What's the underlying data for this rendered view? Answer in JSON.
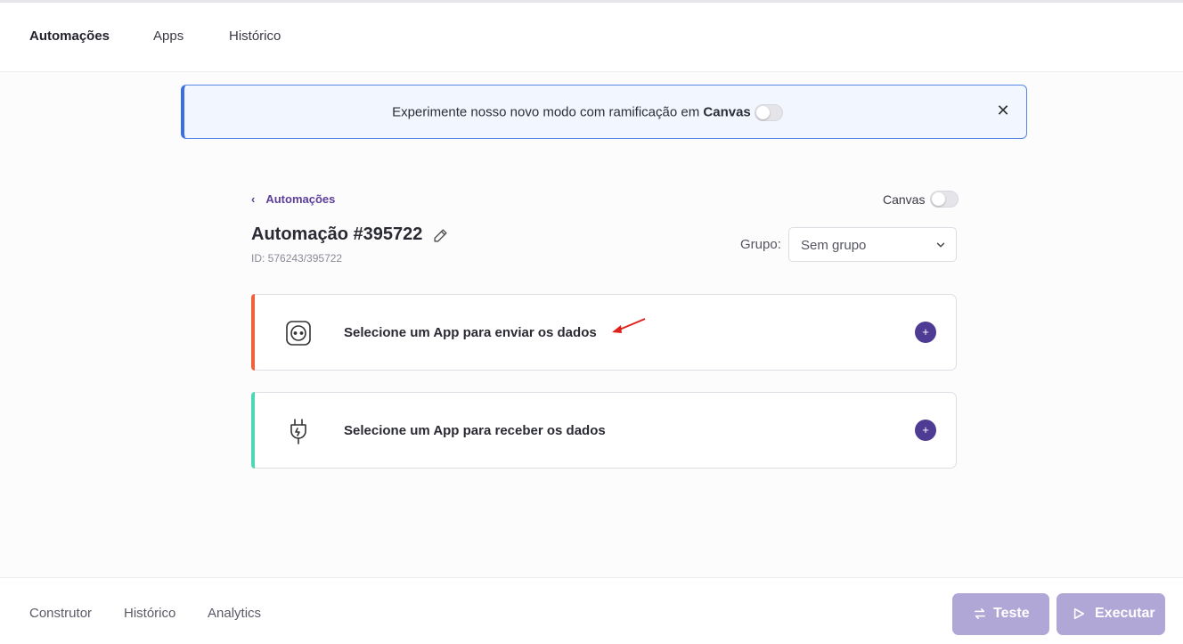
{
  "nav": {
    "tabs": [
      {
        "label": "Automações",
        "active": true
      },
      {
        "label": "Apps",
        "active": false
      },
      {
        "label": "Histórico",
        "active": false
      }
    ]
  },
  "banner": {
    "text": "Experimente nosso novo modo com ramificação em",
    "highlight": "Canvas",
    "toggle_on": false,
    "close_icon": "close-icon"
  },
  "header": {
    "back_label": "Automações",
    "canvas_label": "Canvas",
    "canvas_toggle_on": false,
    "title": "Automação #395722",
    "id_text": "ID: 576243/395722",
    "group_label": "Grupo:",
    "group_value": "Sem grupo"
  },
  "steps": [
    {
      "label": "Selecione um App para enviar os dados",
      "accent": "#f0623a",
      "icon": "socket-icon"
    },
    {
      "label": "Selecione um App para receber os dados",
      "accent": "#4fd6b5",
      "icon": "plug-icon"
    }
  ],
  "footer": {
    "tabs": [
      "Construtor",
      "Histórico",
      "Analytics"
    ],
    "test_label": "Teste",
    "run_label": "Executar"
  },
  "colors": {
    "primary": "#4e3b93",
    "button_disabled": "#b1a7d6",
    "banner_border": "#3b6fe0",
    "annotation_arrow": "#e0201a"
  }
}
